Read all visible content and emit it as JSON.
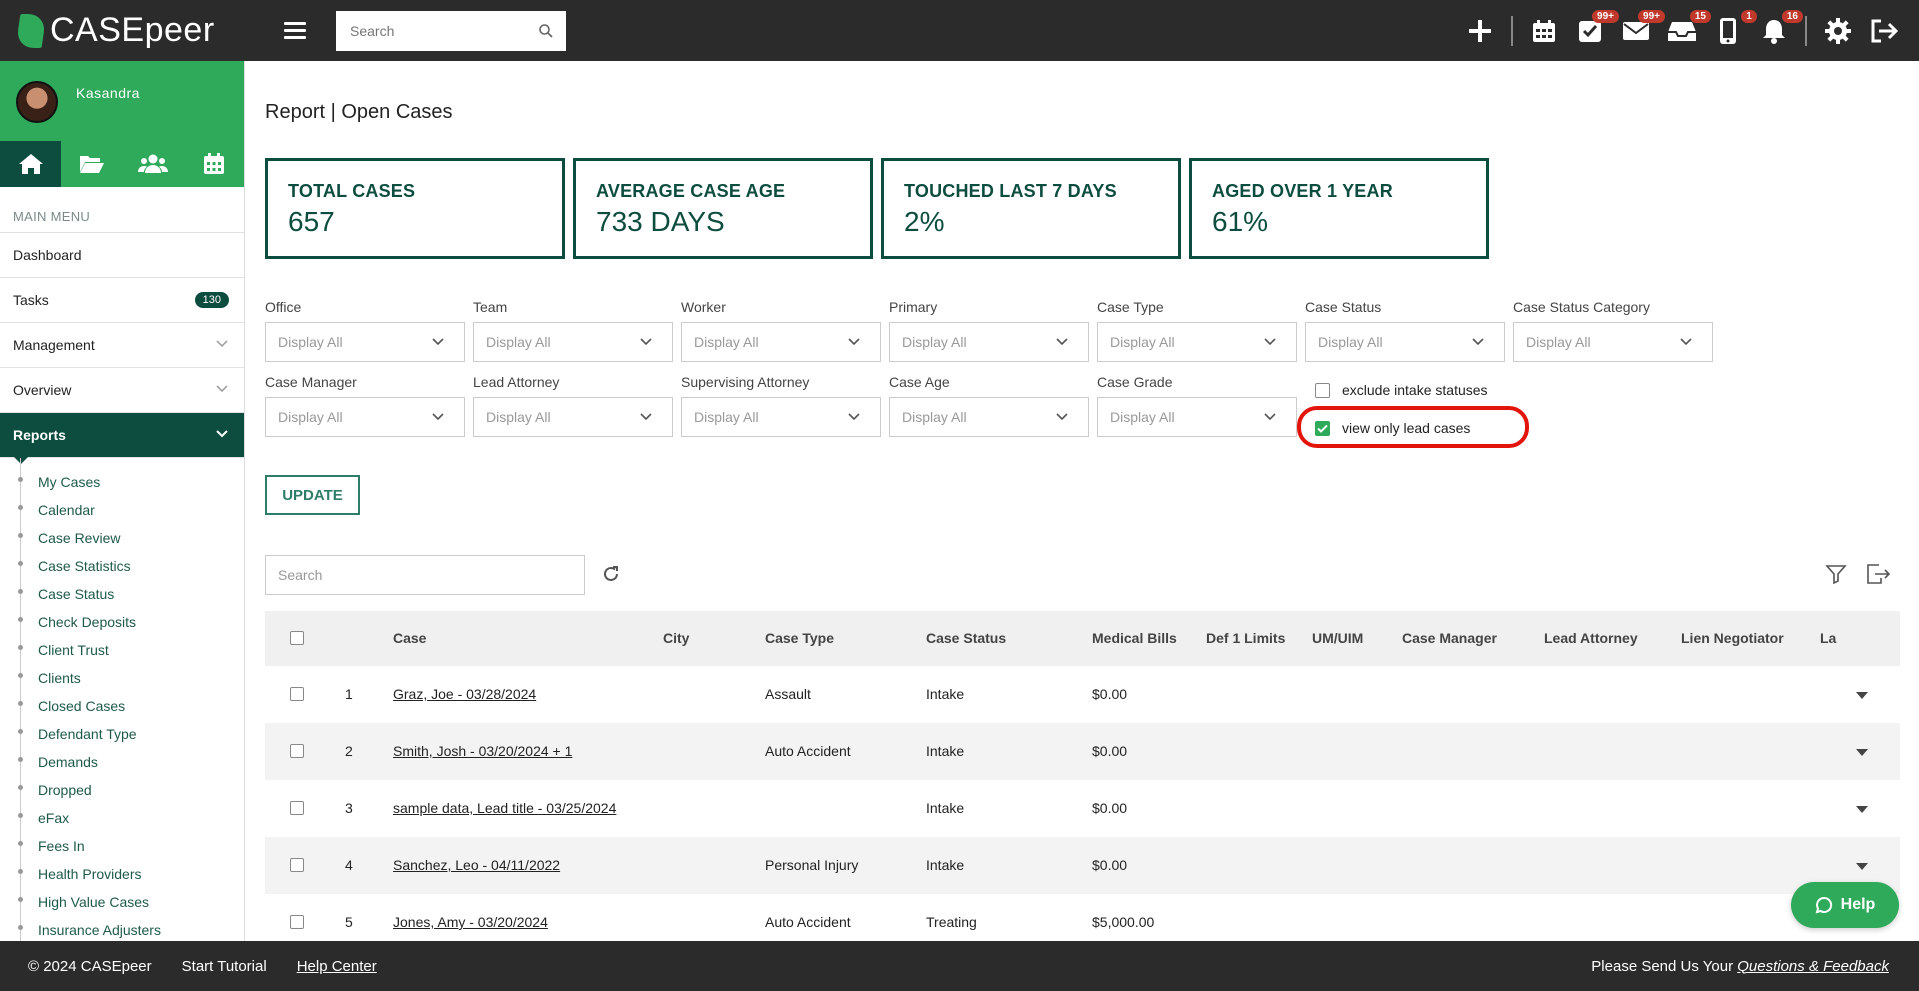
{
  "app": {
    "logo_text": "CASEpeer"
  },
  "topbar": {
    "search_placeholder": "Search",
    "badges": {
      "tasks": "99+",
      "mail": "99+",
      "inbox": "15",
      "phone": "1",
      "notifications": "16"
    }
  },
  "sidebar": {
    "user_name": "Kasandra",
    "main_menu_label": "MAIN MENU",
    "items": [
      {
        "label": "Dashboard"
      },
      {
        "label": "Tasks",
        "count": "130"
      },
      {
        "label": "Management"
      },
      {
        "label": "Overview"
      },
      {
        "label": "Reports"
      }
    ],
    "report_links": [
      "My Cases",
      "Calendar",
      "Case Review",
      "Case Statistics",
      "Case Status",
      "Check Deposits",
      "Client Trust",
      "Clients",
      "Closed Cases",
      "Defendant Type",
      "Demands",
      "Dropped",
      "eFax",
      "Fees In",
      "Health Providers",
      "High Value Cases",
      "Insurance Adjusters"
    ]
  },
  "page": {
    "title": "Report | Open Cases"
  },
  "stats": [
    {
      "label": "TOTAL CASES",
      "value": "657"
    },
    {
      "label": "AVERAGE CASE AGE",
      "value": "733 DAYS"
    },
    {
      "label": "TOUCHED LAST 7 DAYS",
      "value": "2%"
    },
    {
      "label": "AGED OVER 1 YEAR",
      "value": "61%"
    }
  ],
  "filters": {
    "default_value": "Display All",
    "row1": [
      "Office",
      "Team",
      "Worker",
      "Primary",
      "Case Type",
      "Case Status",
      "Case Status Category"
    ],
    "row2": [
      "Case Manager",
      "Lead Attorney",
      "Supervising Attorney",
      "Case Age",
      "Case Grade"
    ],
    "exclude_intake_label": "exclude intake statuses",
    "exclude_intake_checked": false,
    "view_lead_label": "view only lead cases",
    "view_lead_checked": true,
    "update_label": "UPDATE"
  },
  "table": {
    "search_placeholder": "Search",
    "headers": [
      "Case",
      "City",
      "Case Type",
      "Case Status",
      "Medical Bills",
      "Def 1 Limits",
      "UM/UIM",
      "Case Manager",
      "Lead Attorney",
      "Lien Negotiator",
      "La"
    ],
    "rows": [
      {
        "num": "1",
        "case": "Graz, Joe - 03/28/2024",
        "city": "",
        "case_type": "Assault",
        "status": "Intake",
        "medical": "$0.00"
      },
      {
        "num": "2",
        "case": "Smith, Josh - 03/20/2024 + 1",
        "city": "",
        "case_type": "Auto Accident",
        "status": "Intake",
        "medical": "$0.00"
      },
      {
        "num": "3",
        "case": "sample data, Lead title - 03/25/2024",
        "city": "",
        "case_type": "",
        "status": "Intake",
        "medical": "$0.00"
      },
      {
        "num": "4",
        "case": "Sanchez, Leo - 04/11/2022",
        "city": "",
        "case_type": "Personal Injury",
        "status": "Intake",
        "medical": "$0.00"
      },
      {
        "num": "5",
        "case": "Jones, Amy - 03/20/2024",
        "city": "",
        "case_type": "Auto Accident",
        "status": "Treating",
        "medical": "$5,000.00"
      }
    ]
  },
  "help": {
    "label": "Help"
  },
  "footer": {
    "copyright": "© 2024 CASEpeer",
    "tutorial": "Start Tutorial",
    "help_center": "Help Center",
    "feedback_prefix": "Please Send Us Your ",
    "feedback_link": "Questions & Feedback"
  },
  "colors": {
    "brand_green": "#2eaa5a",
    "dark_green": "#0c4d3f",
    "topbar": "#2b2b2b",
    "badge_red": "#c0392b",
    "highlight_red": "#e3140a"
  }
}
